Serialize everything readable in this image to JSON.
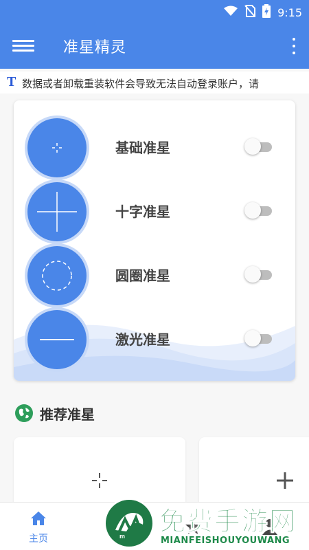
{
  "status": {
    "time": "9:15"
  },
  "appbar": {
    "title": "准星精灵"
  },
  "marquee": {
    "prefix_icon": "T",
    "text": "数据或者卸载重装软件会导致无法自动登录账户，请"
  },
  "crosshairs": [
    {
      "label": "基础准星",
      "icon": "basic-crosshair-icon",
      "enabled": false
    },
    {
      "label": "十字准星",
      "icon": "cross-crosshair-icon",
      "enabled": false
    },
    {
      "label": "圆圈准星",
      "icon": "circle-crosshair-icon",
      "enabled": false
    },
    {
      "label": "激光准星",
      "icon": "laser-crosshair-icon",
      "enabled": false
    }
  ],
  "recommended": {
    "title": "推荐准星"
  },
  "nav": {
    "home_label": "主页"
  },
  "watermark": {
    "title": "免费手游网",
    "subtitle": "MIANFEISHOUYOUWANG"
  },
  "colors": {
    "primary": "#4a86e8",
    "accent_green": "#1e8a4a"
  }
}
